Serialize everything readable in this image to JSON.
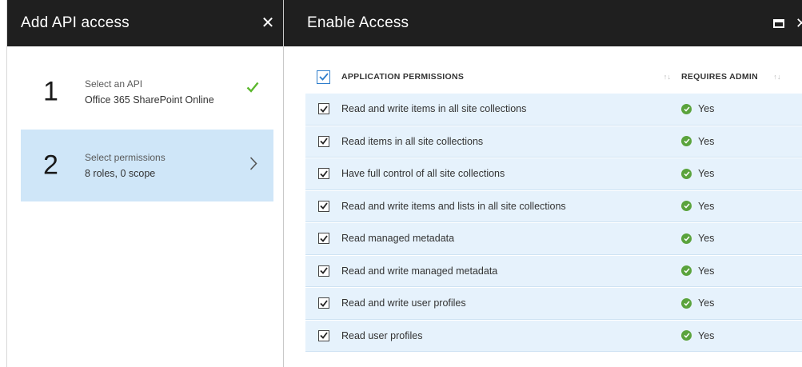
{
  "left_blade": {
    "title": "Add API access",
    "close_icon": "close-icon",
    "steps": [
      {
        "number": "1",
        "title": "Select an API",
        "subtitle": "Office 365 SharePoint Online",
        "status": "complete",
        "status_icon": "check-icon"
      },
      {
        "number": "2",
        "title": "Select permissions",
        "subtitle": "8 roles, 0 scope",
        "status": "active",
        "status_icon": "chevron-right-icon"
      }
    ]
  },
  "right_blade": {
    "title": "Enable Access",
    "icons": [
      "maximize-icon",
      "close-icon"
    ],
    "table": {
      "headers": {
        "permissions": "APPLICATION PERMISSIONS",
        "admin": "REQUIRES ADMIN"
      },
      "header_checked": true,
      "rows": [
        {
          "permission": "Read and write items in all site collections",
          "requires_admin": "Yes",
          "checked": true
        },
        {
          "permission": "Read items in all site collections",
          "requires_admin": "Yes",
          "checked": true
        },
        {
          "permission": "Have full control of all site collections",
          "requires_admin": "Yes",
          "checked": true
        },
        {
          "permission": "Read and write items and lists in all site collections",
          "requires_admin": "Yes",
          "checked": true
        },
        {
          "permission": "Read managed metadata",
          "requires_admin": "Yes",
          "checked": true
        },
        {
          "permission": "Read and write managed metadata",
          "requires_admin": "Yes",
          "checked": true
        },
        {
          "permission": "Read and write user profiles",
          "requires_admin": "Yes",
          "checked": true
        },
        {
          "permission": "Read user profiles",
          "requires_admin": "Yes",
          "checked": true
        }
      ]
    }
  },
  "colors": {
    "header_bg": "#1f1f1f",
    "active_step_bg": "#cfe6f8",
    "row_bg": "#e6f2fc",
    "check_green": "#5cb82e",
    "yes_green": "#5aa33c",
    "header_checkbox": "#2e7dcb"
  }
}
